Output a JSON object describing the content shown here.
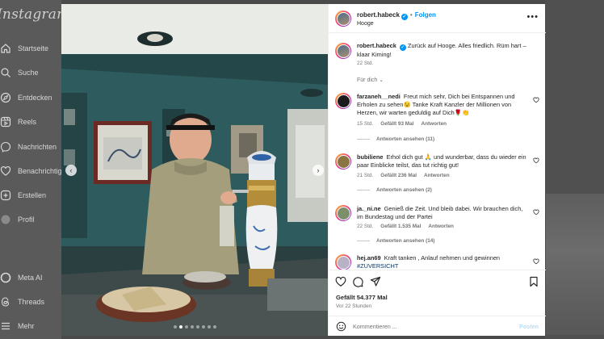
{
  "sidebar": {
    "logo": "Instagram",
    "items": [
      {
        "label": "Startseite",
        "icon": "home-icon"
      },
      {
        "label": "Suche",
        "icon": "search-icon"
      },
      {
        "label": "Entdecken",
        "icon": "compass-icon"
      },
      {
        "label": "Reels",
        "icon": "reels-icon"
      },
      {
        "label": "Nachrichten",
        "icon": "messenger-icon"
      },
      {
        "label": "Benachrichtigungen",
        "icon": "heart-icon"
      },
      {
        "label": "Erstellen",
        "icon": "plus-icon"
      },
      {
        "label": "Profil",
        "icon": "avatar-icon"
      },
      {
        "label": "Meta AI",
        "icon": "meta-ai-icon"
      },
      {
        "label": "Threads",
        "icon": "threads-icon"
      },
      {
        "label": "Mehr",
        "icon": "menu-icon"
      }
    ]
  },
  "post": {
    "username": "robert.habeck",
    "follow_label": "Folgen",
    "location": "Hooge",
    "caption": "Zurück auf Hooge. Alles friedlich. Rüm hart – klaar Kiming!",
    "caption_time": "22 Std.",
    "for_you_label": "Für dich",
    "image_count": 8,
    "active_image": 2
  },
  "comments": [
    {
      "username": "farzaneh__nedi",
      "text": "Freut mich sehr, Dich bei Entspannen und Erholen zu sehen😉 Tanke Kraft Kanzler der Millionen von Herzen, wir warten geduldig auf Dich🌹👏",
      "time": "15 Std.",
      "likes": "Gefällt 93 Mal",
      "reply_label": "Antworten",
      "view_replies": "Antworten ansehen (11)"
    },
    {
      "username": "bubiliene",
      "text": "Erhol dich gut 🙏 und wunderbar, dass du wieder ein paar Einblicke teilst, das tut richtig gut!",
      "time": "21 Std.",
      "likes": "Gefällt 236 Mal",
      "reply_label": "Antworten",
      "view_replies": "Antworten ansehen (2)"
    },
    {
      "username": "ja._ni.ne",
      "text": "Genieß die Zeit. Und bleib dabei. Wir brauchen dich, im Bundestag und der Partei",
      "time": "22 Std.",
      "likes": "Gefällt 1.535 Mal",
      "reply_label": "Antworten",
      "view_replies": "Antworten ansehen (14)"
    },
    {
      "username": "hej.an69",
      "text": "Kraft tanken , Anlauf nehmen und gewinnen",
      "hashtag": "#ZUVERSICHT"
    }
  ],
  "actions": {
    "likes_count": "Gefällt 54.377 Mal",
    "time_ago": "Vor 22 Stunden",
    "comment_placeholder": "Kommentieren ...",
    "post_label": "Posten"
  },
  "colors": {
    "accent": "#0095f6",
    "overlay": "#4a4a4a",
    "text": "#262626",
    "muted": "#737373"
  }
}
